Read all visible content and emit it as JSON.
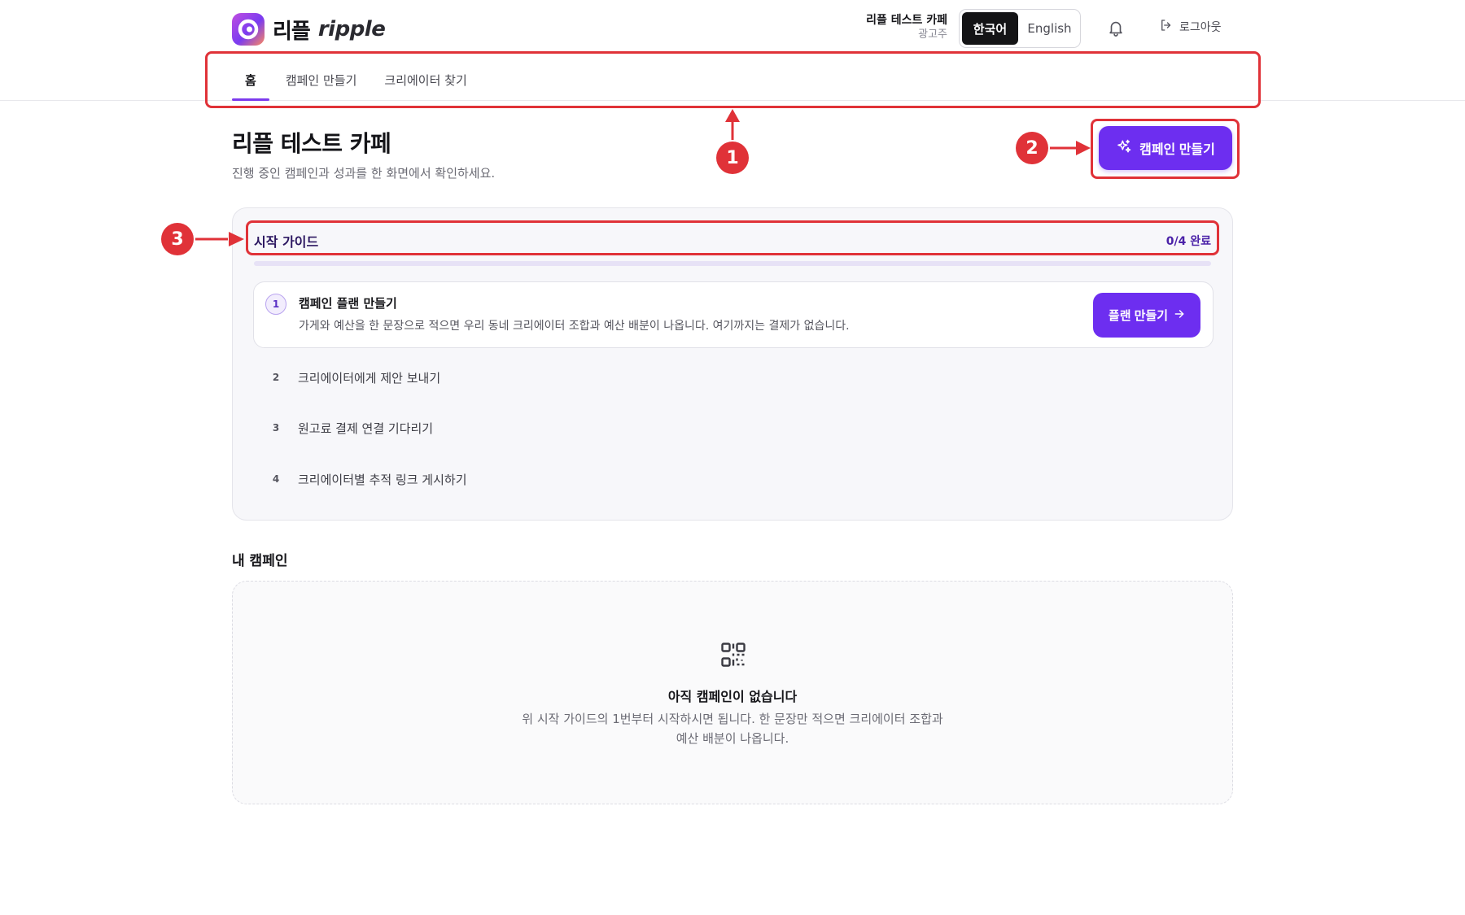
{
  "brand": {
    "name_ko": "리플",
    "name_en": "ripple"
  },
  "account": {
    "name": "리플 테스트 카페",
    "role": "광고주"
  },
  "language": {
    "options": [
      "한국어",
      "English"
    ],
    "selected": "한국어"
  },
  "header": {
    "logout_label": "로그아웃",
    "notification_icon": "bell-icon",
    "logout_icon": "logout-icon"
  },
  "nav": {
    "tabs": [
      {
        "label": "홈",
        "active": true
      },
      {
        "label": "캠페인 만들기",
        "active": false
      },
      {
        "label": "크리에이터 찾기",
        "active": false
      }
    ]
  },
  "page": {
    "title": "리플 테스트 카페",
    "subtitle": "진행 중인 캠페인과 성과를 한 화면에서 확인하세요.",
    "create_button": "캠페인 만들기",
    "create_button_icon": "sparkles-icon"
  },
  "guide": {
    "title": "시작 가이드",
    "progress_text": "0/4 완료",
    "progress_fraction": 0,
    "current_step": {
      "number": "1",
      "title": "캠페인 플랜 만들기",
      "description": "가게와 예산을 한 문장으로 적으면 우리 동네 크리에이터 조합과 예산 배분이 나옵니다. 여기까지는 결제가 없습니다.",
      "button": "플랜 만들기"
    },
    "steps": [
      {
        "number": "2",
        "label": "크리에이터에게 제안 보내기"
      },
      {
        "number": "3",
        "label": "원고료 결제 연결 기다리기"
      },
      {
        "number": "4",
        "label": "크리에이터별 추적 링크 게시하기"
      }
    ]
  },
  "campaigns": {
    "title": "내 캠페인",
    "empty_icon": "qr-code-icon",
    "empty_title": "아직 캠페인이 없습니다",
    "empty_description": "위 시작 가이드의 1번부터 시작하시면 됩니다. 한 문장만 적으면 크리에이터 조합과 예산 배분이 나옵니다."
  },
  "annotations": {
    "labels": [
      "1",
      "2",
      "3"
    ],
    "color": "#e03238"
  },
  "colors": {
    "accent": "#6d2ef0",
    "accent_dark": "#4b22a8",
    "annotation": "#e03238"
  }
}
